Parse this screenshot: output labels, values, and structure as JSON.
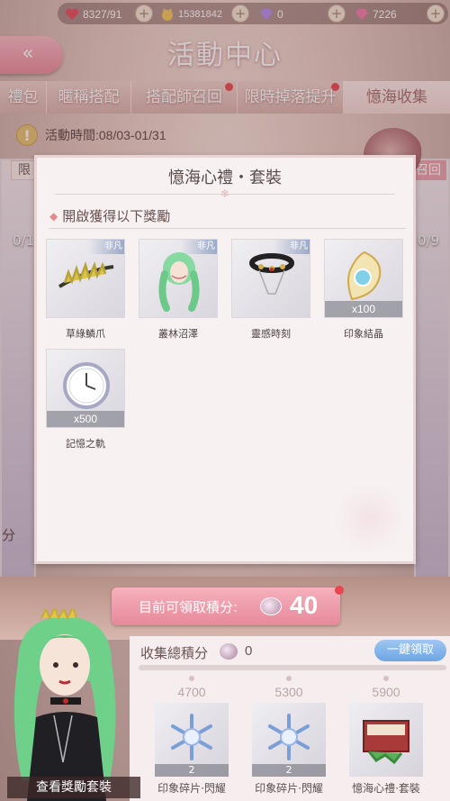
{
  "resources": [
    {
      "icon": "heart-icon",
      "value": "8327/91"
    },
    {
      "icon": "cat-coin-icon",
      "value": "15381842"
    },
    {
      "icon": "diamond-icon",
      "value": "0"
    },
    {
      "icon": "pink-diamond-icon",
      "value": "7226"
    }
  ],
  "header": {
    "back_label": "«",
    "title": "活動中心"
  },
  "tabs": [
    {
      "label": "禮包",
      "active": false,
      "dot": false
    },
    {
      "label": "暱稱搭配",
      "active": false,
      "dot": false
    },
    {
      "label": "搭配師召回",
      "active": false,
      "dot": true
    },
    {
      "label": "限時掉落提升",
      "active": false,
      "dot": true
    },
    {
      "label": "憶海收集",
      "active": true,
      "dot": false
    }
  ],
  "event": {
    "time_label": "活動時間:08/03-01/31",
    "left_count": "0/1",
    "right_count": "0/9",
    "left_tab": "限",
    "right_tab": "召回",
    "left_footer": "分"
  },
  "dialog": {
    "title": "憶海心禮・套裝",
    "section_label": "開啟獲得以下獎勵",
    "items": [
      {
        "name": "草綠鱗爪",
        "tag": "非凡",
        "qty": "",
        "icon": "hair-clip-icon"
      },
      {
        "name": "叢林沼澤",
        "tag": "非凡",
        "qty": "",
        "icon": "green-hair-icon"
      },
      {
        "name": "靈感時刻",
        "tag": "非凡",
        "qty": "",
        "icon": "choker-icon"
      },
      {
        "name": "印象結晶",
        "tag": "",
        "qty": "x100",
        "icon": "crystal-icon"
      },
      {
        "name": "記憶之軌",
        "tag": "",
        "qty": "x500",
        "icon": "clock-icon"
      }
    ]
  },
  "points": {
    "label": "目前可領取積分:",
    "value": "40"
  },
  "collect": {
    "title": "收集總積分",
    "count": "0",
    "claim_label": "一鍵領取",
    "progress": 0,
    "milestones": [
      {
        "score": "4700",
        "name": "印象碎片·閃耀",
        "qty": "2",
        "icon": "snowflake-icon"
      },
      {
        "score": "5300",
        "name": "印象碎片·閃耀",
        "qty": "2",
        "icon": "snowflake-icon"
      },
      {
        "score": "5900",
        "name": "憶海心禮·套裝",
        "qty": "",
        "icon": "gift-box-icon"
      }
    ]
  },
  "avatar": {
    "button_label": "查看獎勵套裝"
  }
}
